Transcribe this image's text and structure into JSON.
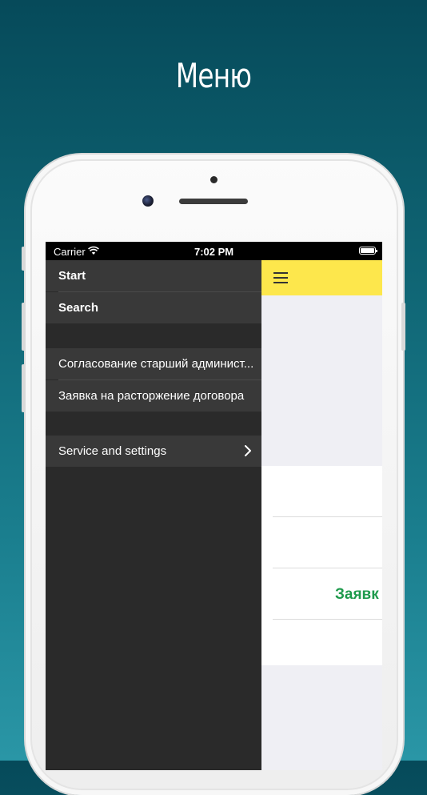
{
  "promo": {
    "title": "Меню"
  },
  "status": {
    "carrier": "Carrier",
    "time": "7:02 PM"
  },
  "menu": {
    "start": "Start",
    "search": "Search",
    "doc1": "Согласование старший админист...",
    "doc2": "Заявка на расторжение договора",
    "settings": "Service and settings"
  },
  "main": {
    "visible_link": "Заявк"
  },
  "colors": {
    "navbar": "#fde74c",
    "drawer": "#2a2a2a",
    "menu_item": "#393939",
    "link": "#1e9a4c"
  },
  "icons": {
    "wifi": "wifi-icon",
    "battery": "battery-icon",
    "menu": "hamburger-icon",
    "chevron": "chevron-right-icon"
  }
}
